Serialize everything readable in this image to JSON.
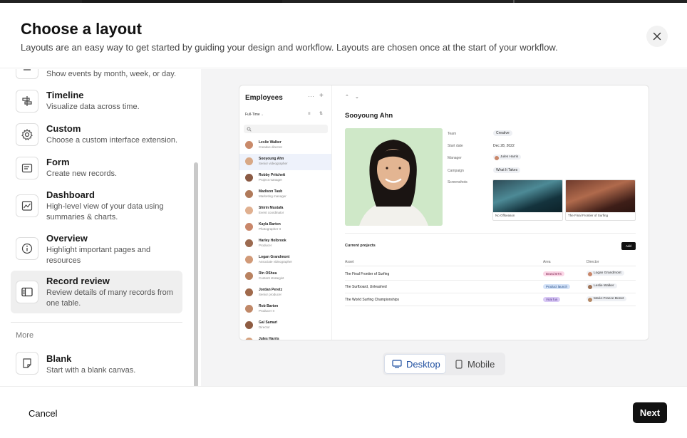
{
  "header": {
    "title": "Choose a layout",
    "subtitle": "Layouts are an easy way to get started by guiding your design and workflow. Layouts are chosen once at the start of your workflow."
  },
  "layouts": [
    {
      "title": "",
      "desc": "Show events by month, week, or day.",
      "icon": "calendar-icon"
    },
    {
      "title": "Timeline",
      "desc": "Visualize data across time.",
      "icon": "timeline-icon"
    },
    {
      "title": "Custom",
      "desc": "Choose a custom interface extension.",
      "icon": "gear-icon"
    },
    {
      "title": "Form",
      "desc": "Create new records.",
      "icon": "form-icon"
    },
    {
      "title": "Dashboard",
      "desc": "High-level view of your data using summaries & charts.",
      "icon": "chart-icon"
    },
    {
      "title": "Overview",
      "desc": "Highlight important pages and resources",
      "icon": "info-icon"
    },
    {
      "title": "Record review",
      "desc": "Review details of many records from one table.",
      "icon": "record-review-icon",
      "selected": true
    }
  ],
  "more_label": "More",
  "blank": {
    "title": "Blank",
    "desc": "Start with a blank canvas.",
    "icon": "blank-page-icon"
  },
  "preview": {
    "list_title": "Employees",
    "filter": "Full-Time",
    "employees": [
      {
        "name": "Leslie Walker",
        "role": "Creative director"
      },
      {
        "name": "Sooyoung Ahn",
        "role": "Senior videographer",
        "selected": true
      },
      {
        "name": "Robby Pritchett",
        "role": "Project manager"
      },
      {
        "name": "Madison Taub",
        "role": "Marketing manager"
      },
      {
        "name": "Shirin Mustafa",
        "role": "Event coordinator"
      },
      {
        "name": "Kayla Barton",
        "role": "Photographer II"
      },
      {
        "name": "Harley Holbrook",
        "role": "Producer"
      },
      {
        "name": "Logan Grandmont",
        "role": "Associate videographer"
      },
      {
        "name": "Rin OShea",
        "role": "Content strategist"
      },
      {
        "name": "Jordan Peretz",
        "role": "Senior producer"
      },
      {
        "name": "Rob Barton",
        "role": "Producer II"
      },
      {
        "name": "Gal Samari",
        "role": "Director"
      },
      {
        "name": "Jules Harris",
        "role": ""
      }
    ],
    "record_name": "Sooyoung Ahn",
    "fields": {
      "team_label": "Team",
      "team": "Creative",
      "start_label": "Start date",
      "start": "Dec 28, 2022",
      "manager_label": "Manager",
      "manager": "Jules Harris",
      "campaign_label": "Campaign",
      "campaign": "What It Takes",
      "screenshots_label": "Screenshots"
    },
    "shots": [
      "No Offseason",
      "The Final Frontier of Surfing"
    ],
    "projects_title": "Current projects",
    "add_label": "Add",
    "columns": [
      "Asset",
      "Area",
      "Director"
    ],
    "rows": [
      {
        "asset": "The Final Frontier of Surfing",
        "area": "Brand BTS",
        "director": "Logan Grandmont"
      },
      {
        "asset": "The Surfboard, Unleashed",
        "area": "Product launch",
        "director": "Leslie Walker"
      },
      {
        "asset": "The World Surfing Championships",
        "area": "Viral fun",
        "director": "Marie-France Bonet"
      }
    ]
  },
  "view_toggle": {
    "desktop": "Desktop",
    "mobile": "Mobile",
    "active": "desktop"
  },
  "footer": {
    "cancel": "Cancel",
    "next": "Next"
  },
  "colors": {
    "primary": "#111111",
    "accent": "#1f4fa0",
    "selected_bg": "#efefef",
    "preview_bg": "#f4f4f5"
  }
}
